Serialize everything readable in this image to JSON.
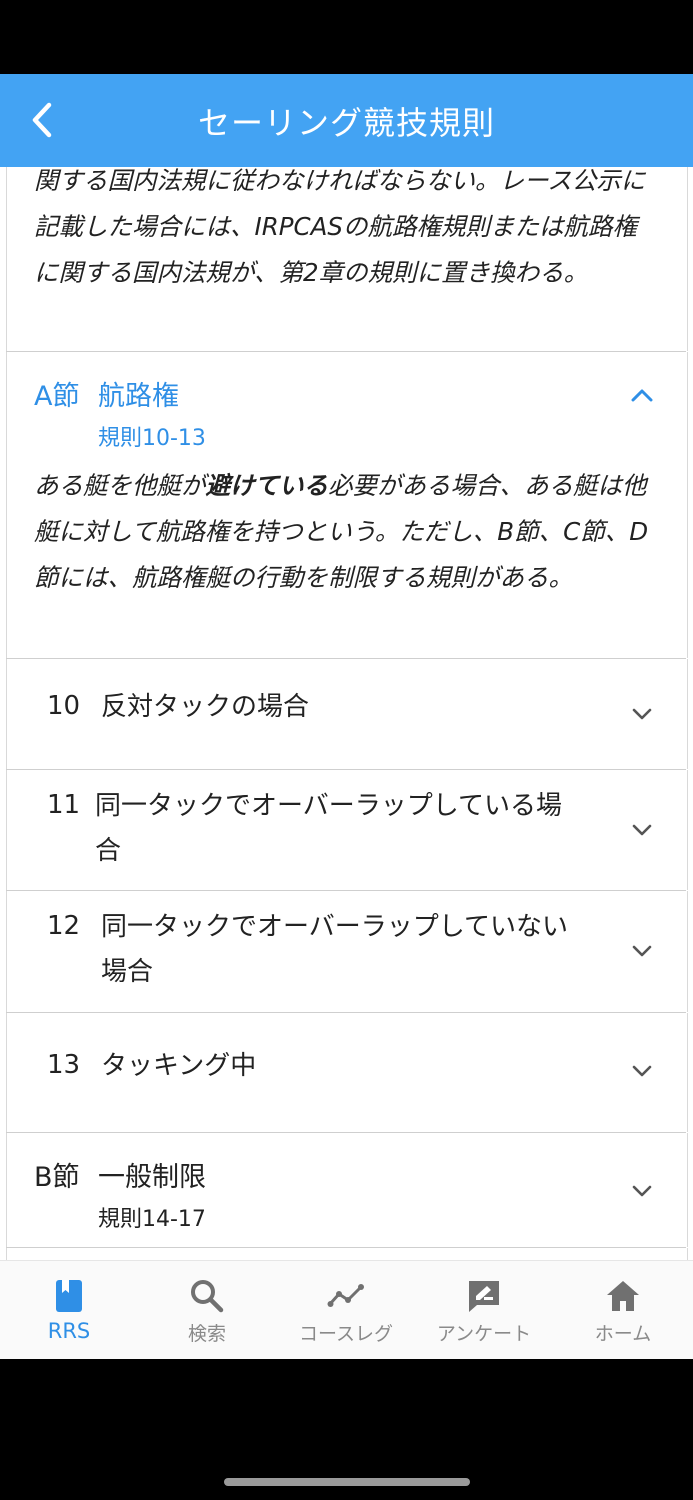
{
  "header": {
    "title": "セーリング競技規則"
  },
  "intro": {
    "text": "関する国内法規に従わなければならない。レース公示に記載した場合には、IRPCASの航路権規則または航路権に関する国内法規が、第2章の規則に置き換わる。"
  },
  "section_a": {
    "letter": "A節",
    "name": "航路権",
    "range": "規則10-13",
    "desc_before": "ある艇を他艇が",
    "desc_bold": "避けている",
    "desc_after": "必要がある場合、ある艇は他艇に対して航路権を持つという。ただし、B節、C節、D節には、航路権艇の行動を制限する規則がある。"
  },
  "rules": [
    {
      "number": "10",
      "title": "反対タックの場合"
    },
    {
      "number": "11",
      "title": "同一タックでオーバーラップしている場合"
    },
    {
      "number": "12",
      "title": "同一タックでオーバーラップしていない場合"
    },
    {
      "number": "13",
      "title": "タッキング中"
    }
  ],
  "section_b": {
    "letter": "B節",
    "name": "一般制限",
    "range": "規則14-17"
  },
  "nav": [
    {
      "label": "RRS",
      "icon": "book-icon"
    },
    {
      "label": "検索",
      "icon": "search-icon"
    },
    {
      "label": "コースレグ",
      "icon": "course-leg-icon"
    },
    {
      "label": "アンケート",
      "icon": "survey-icon"
    },
    {
      "label": "ホーム",
      "icon": "home-icon"
    }
  ],
  "colors": {
    "header": "#43a3f3",
    "accent": "#2f8fe6"
  }
}
